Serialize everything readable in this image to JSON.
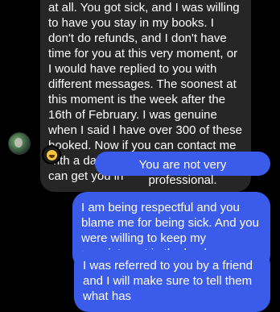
{
  "messages": [
    {
      "direction": "incoming",
      "text": "at all. You got sick, and I was willing to have you stay in my books. I don't do refunds, and I don't have time for you at this very moment, or I would have replied to you with different messages. The soonest at this moment is the week after the 16th of February. I was genuine when I said I have over 300 of these booked. Now if you can contact me with a day and time after Feb 16th I can get you in",
      "reaction": "laughing-emoji"
    },
    {
      "direction": "outgoing",
      "text": "You are not very professional."
    },
    {
      "direction": "outgoing",
      "text": "I am being respectful and you blame me for being sick. And you were willing to keep my appointment in the books."
    },
    {
      "direction": "outgoing",
      "text": "I was referred to you by a friend and I will make sure to tell them what has"
    }
  ],
  "colors": {
    "background": "#000000",
    "incoming_bubble": "#262626",
    "outgoing_bubble": "#3b5bea",
    "text": "#ffffff"
  }
}
